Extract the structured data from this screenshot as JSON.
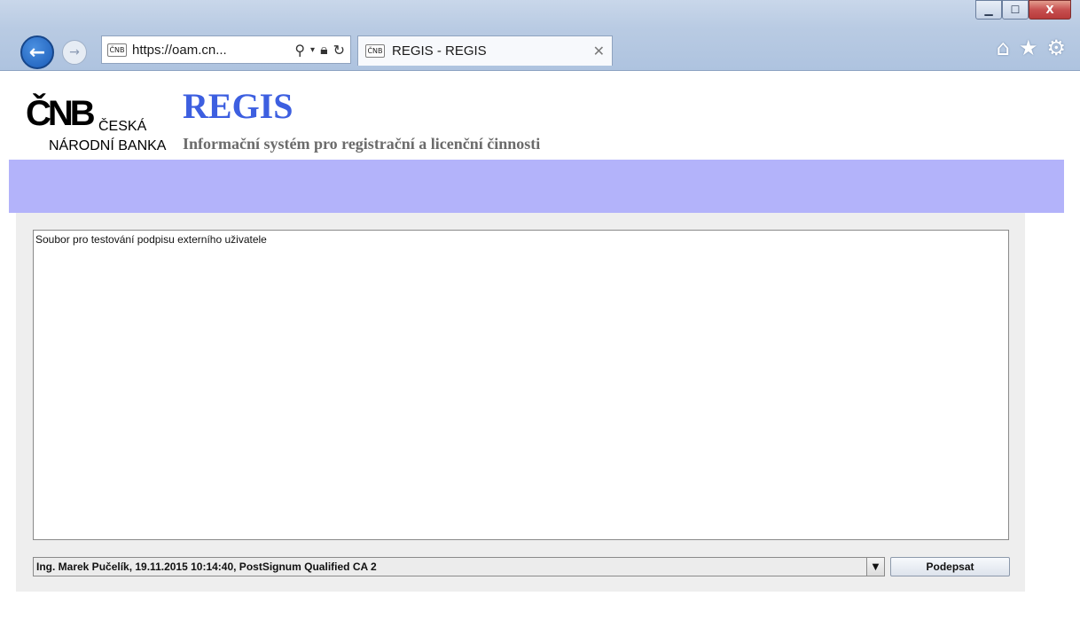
{
  "window": {
    "minimize_icon": "minimize-icon",
    "maximize_icon": "maximize-icon",
    "close_label": "X"
  },
  "browser": {
    "back_icon": "back-arrow-icon",
    "forward_icon": "forward-arrow-icon",
    "address_url": "https://oam.cn...",
    "tab_title": "REGIS - REGIS",
    "favicon_text": "ČNB",
    "toolbar_icons": [
      "home-icon",
      "star-icon",
      "gear-icon"
    ]
  },
  "header": {
    "logo_cnb": "ČNB",
    "logo_line1": "ČESKÁ",
    "logo_line2": "NÁRODNÍ BANKA",
    "title": "REGIS",
    "subtitle": "Informační systém pro registrační a licenční činnosti"
  },
  "applet": {
    "document_text": "Soubor pro testování podpisu externího uživatele",
    "certificate": "Ing. Marek Pučelík, 19.11.2015 10:14:40, PostSignum Qualified CA 2",
    "sign_button": "Podepsat"
  },
  "colors": {
    "banner": "#b3b3fa",
    "title": "#3d5fe0",
    "subtitle": "#6b6b6b"
  }
}
